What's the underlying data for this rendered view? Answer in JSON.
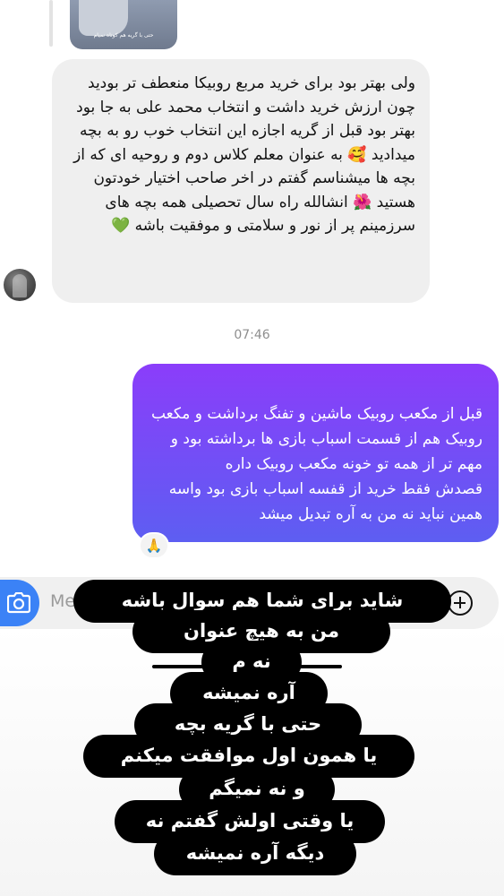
{
  "reply_preview": {
    "caption": "حتی با گریه هم کوتاه نمیام"
  },
  "incoming_message": {
    "text": "ولی بهتر بود برای خرید مربع روبیکا منعطف تر بودید چون ارزش خرید داشت و انتخاب محمد علی به جا بود بهتر بود قبل از گریه اجازه این انتخاب خوب رو به بچه میدادید 🥰 به عنوان معلم کلاس دوم و روحیه ای که از بچه ها میشناسم گفتم در اخر صاحب اختیار خودتون هستید 🌺 انشالله راه سال تحصیلی همه بچه های سرزمینم پر از نور و سلامتی و موفقیت باشه 💚"
  },
  "timestamp": "07:46",
  "outgoing_message": {
    "text": "قبل از مکعب روبیک ماشین و تفنگ برداشت و مکعب روبیک هم از قسمت اسباب بازی ها برداشته بود و مهم تر از همه تو خونه مکعب روبیک داره\nقصدش فقط خرید از قفسه اسباب بازی بود واسه همین نباید نه من به آره تبدیل میشد"
  },
  "reaction": "🙏",
  "composer": {
    "placeholder": "Me"
  },
  "story_overlay": {
    "lines": [
      "شاید برای شما هم سوال باشه",
      "من به هیچ عنوان",
      "نه م",
      "آره نمیشه",
      "حتی با گریه بچه",
      "یا همون اول موافقت میکنم",
      "و نه نمیگم",
      "یا وقتی اولش گفتم نه",
      "دیگه آره نمیشه"
    ]
  },
  "colors": {
    "outgoing_gradient_top": "#8b3dfa",
    "outgoing_gradient_bottom": "#5d5ef2",
    "incoming_bubble": "#efefef",
    "camera_button": "#3b82f6"
  },
  "icons": {
    "camera": "camera-icon",
    "plus": "plus-icon"
  }
}
